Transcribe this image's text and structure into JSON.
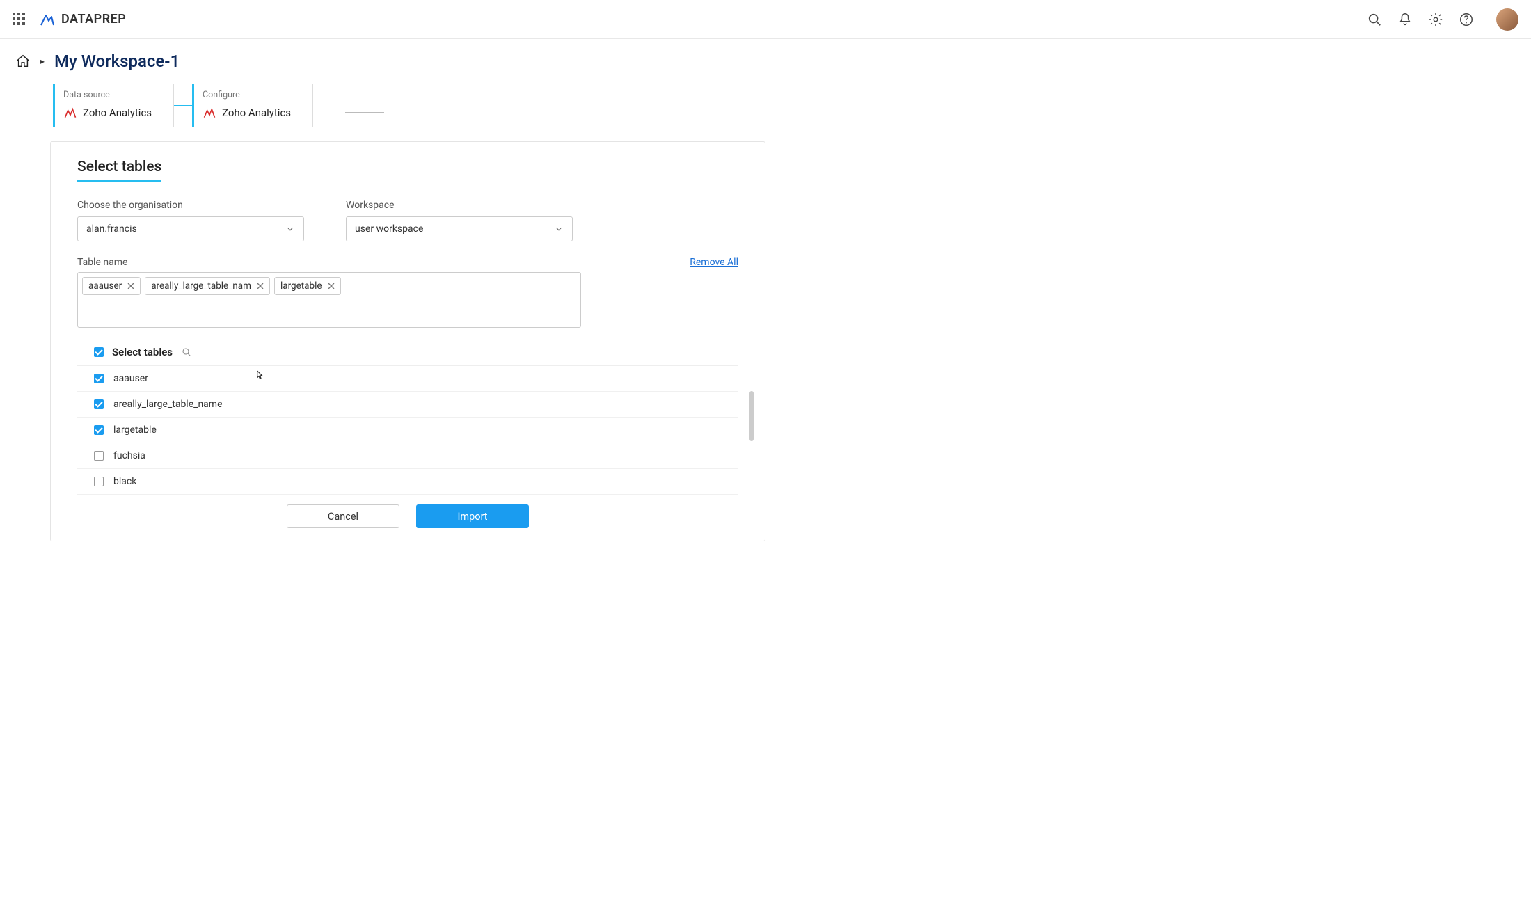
{
  "header": {
    "app_name": "DATAPREP"
  },
  "breadcrumb": {
    "title": "My Workspace-1"
  },
  "steps": [
    {
      "label": "Data source",
      "name": "Zoho Analytics"
    },
    {
      "label": "Configure",
      "name": "Zoho Analytics"
    }
  ],
  "panel": {
    "title": "Select tables",
    "org_label": "Choose the organisation",
    "org_value": "alan.francis",
    "workspace_label": "Workspace",
    "workspace_value": "user workspace",
    "tablename_label": "Table name",
    "remove_all": "Remove All",
    "chips": [
      {
        "text": "aaauser"
      },
      {
        "text": "areally_large_table_nam"
      },
      {
        "text": "largetable"
      }
    ],
    "list_header": "Select tables",
    "tables": [
      {
        "name": "aaauser",
        "checked": true
      },
      {
        "name": "areally_large_table_name",
        "checked": true
      },
      {
        "name": "largetable",
        "checked": true
      },
      {
        "name": "fuchsia",
        "checked": false
      },
      {
        "name": "black",
        "checked": false
      }
    ],
    "cancel": "Cancel",
    "import": "Import"
  }
}
